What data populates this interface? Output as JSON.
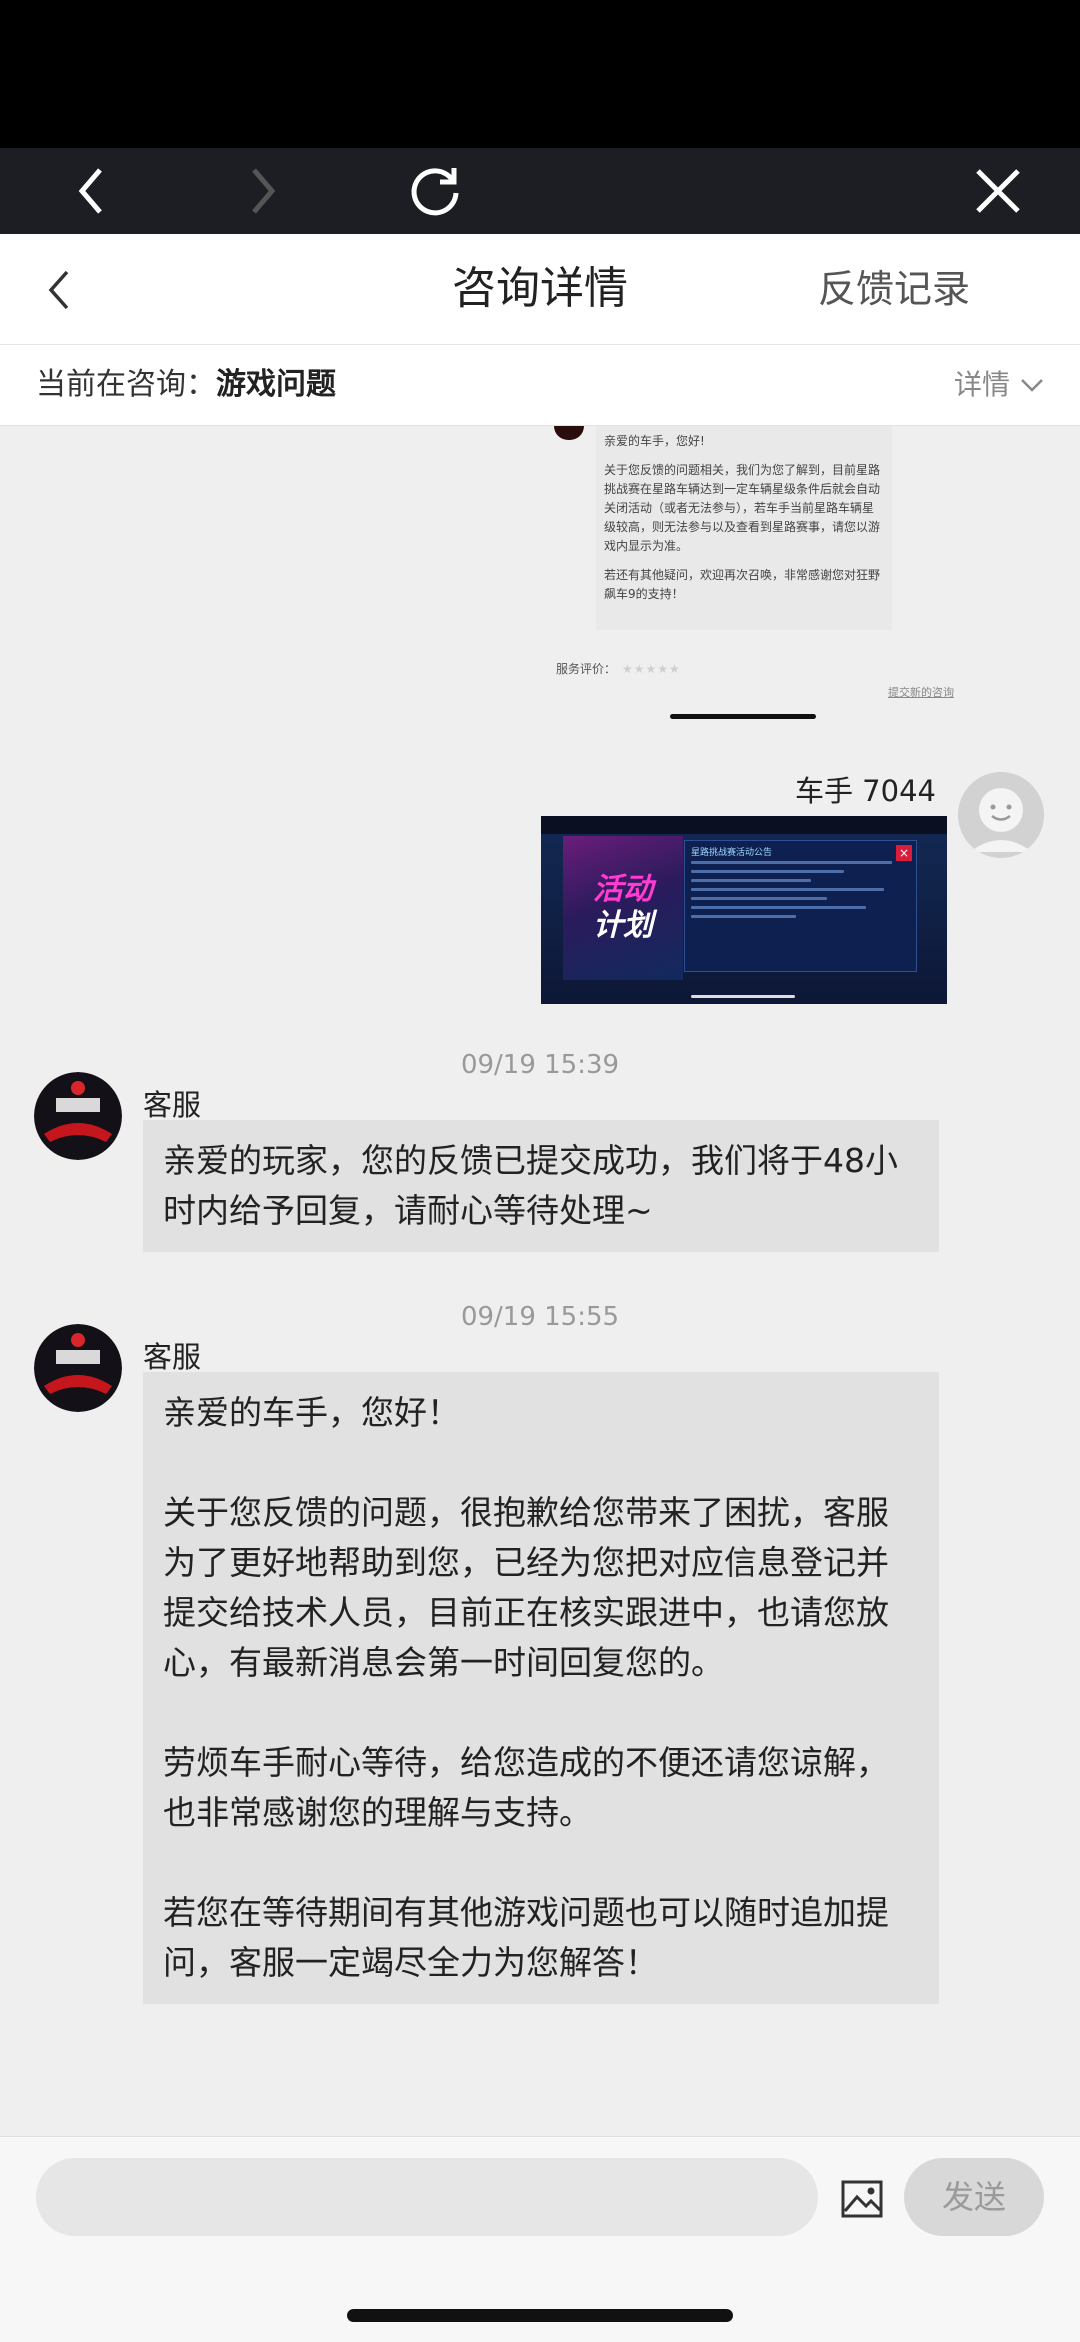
{
  "browser": {
    "back_icon": "chevron-left-icon",
    "forward_icon": "chevron-right-icon",
    "reload_icon": "reload-icon",
    "close_icon": "close-icon"
  },
  "header": {
    "title": "咨询详情",
    "feedback_link": "反馈记录"
  },
  "topic": {
    "label": "当前在咨询：",
    "value": "游戏问题",
    "details": "详情"
  },
  "prior_screenshot": {
    "greeting": "亲爱的车手，您好!",
    "body": "关于您反馈的问题相关，我们为您了解到，目前星路挑战赛在星路车辆达到一定车辆星级条件后就会自动关闭活动（或者无法参与），若车手当前星路车辆星级较高，则无法参与以及查看到星路赛事，请您以游戏内显示为准。",
    "closing": "若还有其他疑问，欢迎再次召唤，非常感谢您对狂野飙车9的支持！",
    "rating_label": "服务评价：",
    "new_link": "提交新的咨询"
  },
  "user_message": {
    "name": "车手 7044",
    "image": {
      "art_line1": "活动",
      "art_line2": "计划",
      "panel_title": "星路挑战赛活动公告"
    }
  },
  "messages": [
    {
      "time": "09/19 15:39",
      "sender": "客服",
      "paragraphs": [
        "亲爱的玩家，您的反馈已提交成功，我们将于48小时内给予回复，请耐心等待处理~"
      ]
    },
    {
      "time": "09/19 15:55",
      "sender": "客服",
      "paragraphs": [
        "亲爱的车手，您好！",
        "关于您反馈的问题，很抱歉给您带来了困扰，客服为了更好地帮助到您，已经为您把对应信息登记并提交给技术人员，目前正在核实跟进中，也请您放心，有最新消息会第一时间回复您的。",
        "劳烦车手耐心等待，给您造成的不便还请您谅解，也非常感谢您的理解与支持。",
        "若您在等待期间有其他游戏问题也可以随时追加提问，客服一定竭尽全力为您解答！"
      ]
    }
  ],
  "input": {
    "placeholder": "",
    "image_icon": "image-icon",
    "send_label": "发送"
  }
}
